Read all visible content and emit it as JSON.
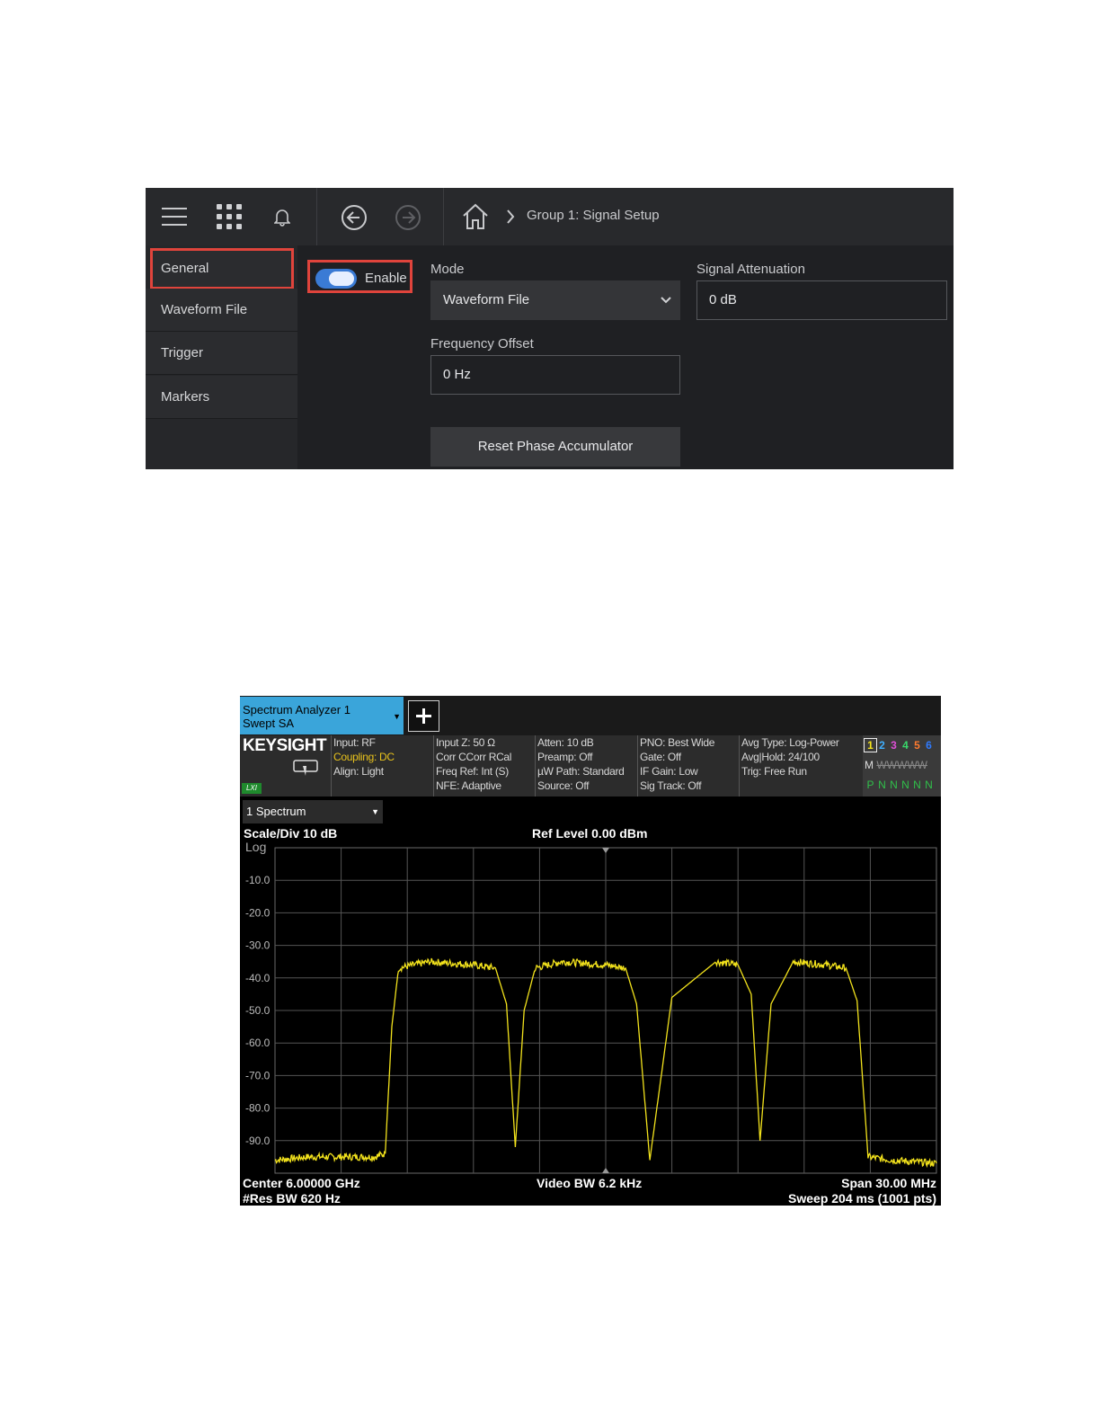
{
  "setup_panel": {
    "breadcrumb": "Group 1: Signal Setup",
    "sidebar": [
      "General",
      "Waveform File",
      "Trigger",
      "Markers"
    ],
    "enable_label": "Enable",
    "enable_on": true,
    "mode_label": "Mode",
    "mode_value": "Waveform File",
    "attenuation_label": "Signal Attenuation",
    "attenuation_value": "0 dB",
    "freq_offset_label": "Frequency Offset",
    "freq_offset_value": "0 Hz",
    "reset_button": "Reset Phase Accumulator",
    "icons": [
      "menu-icon",
      "apps-grid-icon",
      "bell-icon",
      "back-icon",
      "forward-icon",
      "home-icon",
      "chevron-right-icon",
      "chevron-down-icon"
    ]
  },
  "analyzer": {
    "tab_line1": "Spectrum Analyzer 1",
    "tab_line2": "Swept SA",
    "brand": "KEYSIGHT",
    "lxi": "LXI",
    "info_columns": [
      [
        "Input: RF",
        "Coupling: DC",
        "Align: Light"
      ],
      [
        "Input Z: 50 Ω",
        "Corr CCorr RCal",
        "Freq Ref: Int (S)",
        "NFE: Adaptive"
      ],
      [
        "Atten: 10 dB",
        "Preamp: Off",
        "µW Path: Standard",
        "Source: Off"
      ],
      [
        "PNO: Best Wide",
        "Gate: Off",
        "IF Gain: Low",
        "Sig Track: Off"
      ],
      [
        "Avg Type: Log-Power",
        "Avg|Hold: 24/100",
        "Trig: Free Run"
      ]
    ],
    "trace_numbers": [
      "1",
      "2",
      "3",
      "4",
      "5",
      "6"
    ],
    "trace_colors": [
      "#f2e21c",
      "#3fb0ff",
      "#e04fd8",
      "#39d96a",
      "#ff7a2e",
      "#2f7bff"
    ],
    "trace_m_row": "M",
    "trace_w_row": "WWWWW",
    "trace_p_row": [
      "P",
      "N",
      "N",
      "N",
      "N",
      "N"
    ],
    "spectrum_selector": "1 Spectrum",
    "scale_div": "Scale/Div 10 dB",
    "scale_type": "Log",
    "ref_level": "Ref Level 0.00 dBm",
    "center": "Center 6.00000 GHz",
    "res_bw": "#Res BW 620 Hz",
    "video_bw": "Video BW 6.2 kHz",
    "span": "Span 30.00 MHz",
    "sweep": "Sweep 204 ms (1001 pts)"
  },
  "chart_data": {
    "type": "line",
    "ylim": [
      -100,
      0
    ],
    "xlim": [
      5985,
      6015
    ],
    "x_unit": "MHz",
    "y_unit": "dBm",
    "y_tick_labels": [
      "-10.0",
      "-20.0",
      "-30.0",
      "-40.0",
      "-50.0",
      "-60.0",
      "-70.0",
      "-80.0",
      "-90.0"
    ],
    "grid": true,
    "trace_color": "#f2e21c",
    "series": [
      {
        "x": [
          5985.0,
          5986.5,
          5988.0,
          5989.5,
          5990.0,
          5990.3,
          5990.6,
          5992.0,
          5994.0,
          5995.0,
          5995.5,
          5995.9,
          5996.3,
          5996.8,
          5998.0,
          6000.0,
          6000.9,
          6001.4,
          6002.0,
          6003.0,
          6005.0,
          6006.0,
          6006.6,
          6007.0,
          6007.5,
          6008.5,
          6010.0,
          6010.9,
          6011.4,
          6011.9,
          6013.0,
          6015.0
        ],
        "y": [
          -96,
          -95,
          -95,
          -95,
          -94,
          -55,
          -37,
          -35,
          -36,
          -37,
          -48,
          -92,
          -50,
          -37,
          -35,
          -36,
          -37,
          -48,
          -96,
          -46,
          -35,
          -36,
          -45,
          -90,
          -48,
          -35,
          -36,
          -37,
          -47,
          -95,
          -96,
          -97
        ]
      }
    ]
  }
}
